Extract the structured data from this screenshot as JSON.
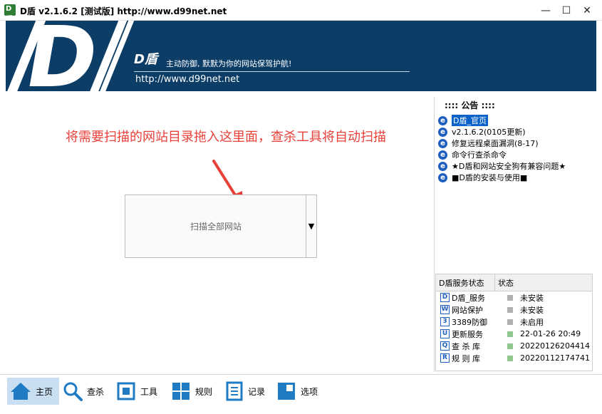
{
  "window": {
    "title": "D盾 v2.1.6.2 [测试版] http://www.d99net.net",
    "app_icon_text": "D盾",
    "minimize": "—",
    "maximize": "☐",
    "close": "✕"
  },
  "banner": {
    "logo": "D",
    "brand": "D盾",
    "slogan": "主动防御, 默默为你的网站保驾护航!",
    "url": "http://www.d99net.net"
  },
  "main": {
    "hint": "将需要扫描的网站目录拖入这里面，查杀工具将自动扫描",
    "scan_button": "扫描全部网站",
    "dropdown": "▼"
  },
  "notice": {
    "title": ":::: 公告 ::::",
    "items": [
      {
        "label": "D盾_官页",
        "selected": true
      },
      {
        "label": "v2.1.6.2(0105更新)"
      },
      {
        "label": "修复远程桌面漏洞(8-17)"
      },
      {
        "label": "命令行查杀命令"
      },
      {
        "label": "★D盾和网站安全狗有兼容问题★"
      },
      {
        "label": "■D盾的安装与使用■"
      }
    ]
  },
  "status": {
    "headers": [
      "D盾服务状态",
      "状态"
    ],
    "rows": [
      {
        "icon": "D",
        "name": "D盾_服务",
        "value": "未安装",
        "color": "#b0b0b0"
      },
      {
        "icon": "W",
        "name": "网站保护",
        "value": "未安装",
        "color": "#b0b0b0"
      },
      {
        "icon": "3",
        "name": "3389防御",
        "value": "未启用",
        "color": "#b0b0b0"
      },
      {
        "icon": "U",
        "name": "更新服务",
        "value": "22-01-26 20:49",
        "color": "#8fc98f"
      },
      {
        "icon": "Q",
        "name": "查 杀 库",
        "value": "20220126204414",
        "color": "#8fc98f"
      },
      {
        "icon": "R",
        "name": "规 则 库",
        "value": "20220112174741",
        "color": "#8fc98f"
      }
    ]
  },
  "toolbar": {
    "items": [
      {
        "label": "主页",
        "icon": "home-icon",
        "active": true
      },
      {
        "label": "查杀",
        "icon": "search-icon"
      },
      {
        "label": "工具",
        "icon": "tools-icon"
      },
      {
        "label": "规则",
        "icon": "rules-icon"
      },
      {
        "label": "记录",
        "icon": "log-icon"
      },
      {
        "label": "选项",
        "icon": "options-icon"
      }
    ]
  },
  "colors": {
    "banner_bg": "#0b3d66",
    "hint_red": "#e8413a",
    "accent_blue": "#1f7bc4"
  }
}
